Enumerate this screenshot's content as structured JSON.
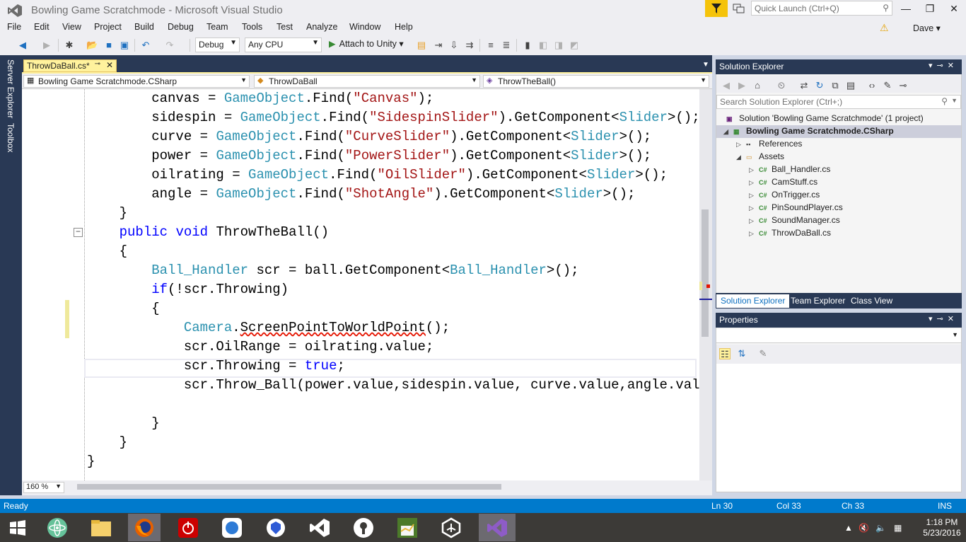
{
  "window": {
    "title": "Bowling Game Scratchmode - Microsoft Visual Studio",
    "user": "Dave"
  },
  "quick_launch": {
    "placeholder": "Quick Launch (Ctrl+Q)"
  },
  "menu": [
    "File",
    "Edit",
    "View",
    "Project",
    "Build",
    "Debug",
    "Team",
    "Tools",
    "Test",
    "Analyze",
    "Window",
    "Help"
  ],
  "toolbar": {
    "config": "Debug",
    "platform": "Any CPU",
    "attach_label": "Attach to Unity"
  },
  "left_strip": {
    "server_explorer": "Server Explorer",
    "toolbox": "Toolbox"
  },
  "document": {
    "tab_title": "ThrowDaBall.cs*",
    "nav_project": "Bowling Game Scratchmode.CSharp",
    "nav_class": "ThrowDaBall",
    "nav_member": "ThrowTheBall()",
    "zoom": "160 %"
  },
  "solution_explorer": {
    "title": "Solution Explorer",
    "search_placeholder": "Search Solution Explorer (Ctrl+;)",
    "solution": "Solution 'Bowling Game Scratchmode' (1 project)",
    "project": "Bowling Game Scratchmode.CSharp",
    "references": "References",
    "assets": "Assets",
    "files": [
      "Ball_Handler.cs",
      "CamStuff.cs",
      "OnTrigger.cs",
      "PinSoundPlayer.cs",
      "SoundManager.cs",
      "ThrowDaBall.cs"
    ],
    "tabs": [
      "Solution Explorer",
      "Team Explorer",
      "Class View"
    ]
  },
  "properties": {
    "title": "Properties"
  },
  "status": {
    "state": "Ready",
    "line": "Ln 30",
    "col": "Col 33",
    "ch": "Ch 33",
    "mode": "INS"
  },
  "clock": {
    "time": "1:18 PM",
    "date": "5/23/2016"
  },
  "colors": {
    "accent": "#007acc",
    "tab_active": "#fff29d",
    "panel_header": "#293955"
  }
}
